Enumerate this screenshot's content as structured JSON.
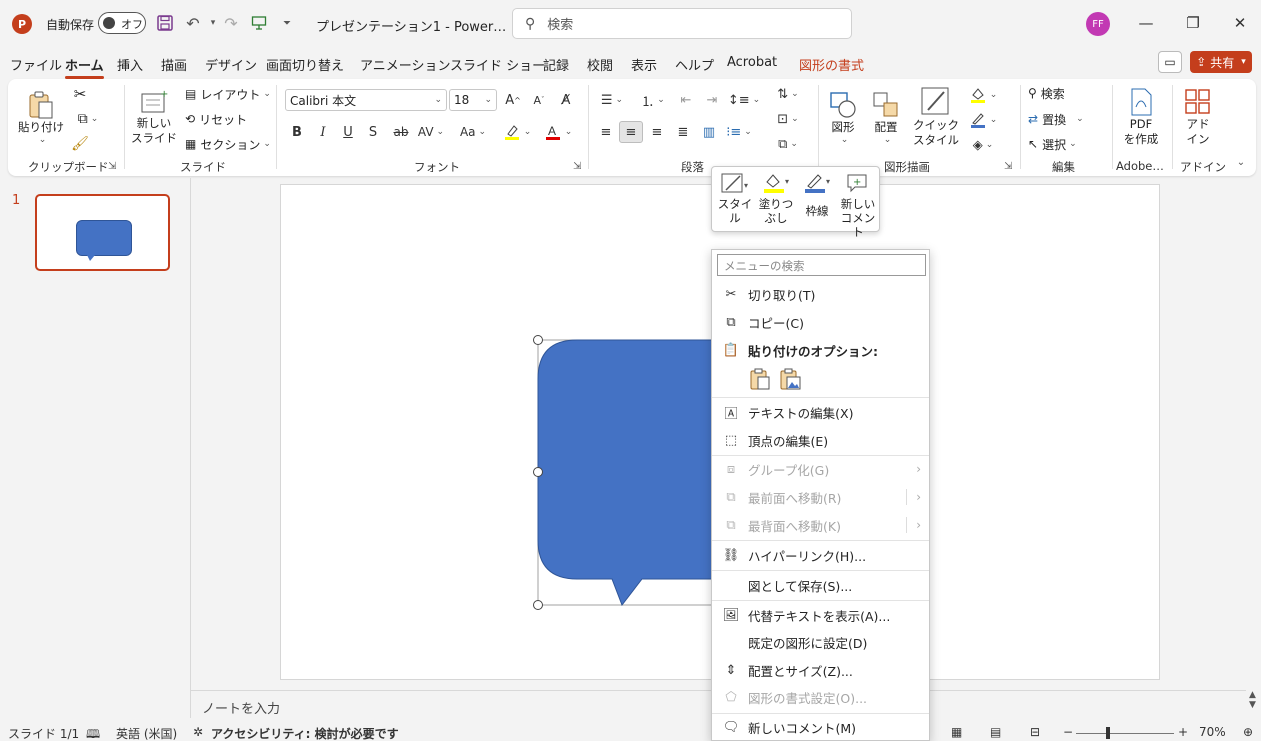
{
  "titlebar": {
    "logo": "P",
    "autosave_label": "自動保存",
    "autosave_state": "オフ",
    "doc_title": "プレゼンテーション1 - Power…",
    "search_placeholder": "検索",
    "user_initials": "FF",
    "icons": [
      "save-icon",
      "undo-icon",
      "redo-icon",
      "present-icon",
      "customize-icon",
      "minimize-icon",
      "restore-icon",
      "close-icon"
    ]
  },
  "menu": {
    "tabs": [
      "ファイル",
      "ホーム",
      "挿入",
      "描画",
      "デザイン",
      "画面切り替え",
      "アニメーション",
      "スライド ショー",
      "記録",
      "校閲",
      "表示",
      "ヘルプ",
      "Acrobat",
      "図形の書式"
    ],
    "active_tab": "ホーム",
    "share_label": "共有"
  },
  "ribbon": {
    "clipboard": {
      "paste": "貼り付け",
      "label": "クリップボード"
    },
    "slides": {
      "new_slide_1": "新しい",
      "new_slide_2": "スライド",
      "layout": "レイアウト",
      "reset": "リセット",
      "section": "セクション",
      "label": "スライド"
    },
    "font": {
      "family": "Calibri 本文",
      "size": "18",
      "bold": "B",
      "italic": "I",
      "underline": "U",
      "shadow": "S",
      "strike": "ab",
      "spacing": "AV",
      "case": "Aa",
      "label": "フォント"
    },
    "paragraph": {
      "label": "段落"
    },
    "drawing": {
      "shapes": "図形",
      "arrange": "配置",
      "quick_1": "クイック",
      "quick_2": "スタイル",
      "label": "図形描画"
    },
    "editing": {
      "find": "検索",
      "replace": "置換",
      "select": "選択",
      "label": "編集"
    },
    "adobe": {
      "pdf_1": "PDF",
      "pdf_2": "を作成",
      "label": "Adobe…"
    },
    "addins": {
      "addin_1": "アド",
      "addin_2": "イン",
      "label": "アドイン"
    },
    "colors": {
      "highlight": "#ffff00",
      "font_color": "#e00000",
      "accent": "#c43e1c"
    }
  },
  "slides_panel": {
    "slide_number": "1"
  },
  "canvas": {
    "shape_fill": "#4472c4",
    "notes_placeholder": "ノートを入力"
  },
  "mini_toolbar": {
    "style_1": "スタイ",
    "style_2": "ル",
    "fill_1": "塗りつ",
    "fill_2": "ぶし",
    "outline": "枠線",
    "comment_1": "新しい",
    "comment_2": "コメント"
  },
  "context_menu": {
    "search_placeholder": "メニューの検索",
    "cut": "切り取り(T)",
    "copy": "コピー(C)",
    "paste_options": "貼り付けのオプション:",
    "edit_text": "テキストの編集(X)",
    "edit_points": "頂点の編集(E)",
    "group": "グループ化(G)",
    "bring_front": "最前面へ移動(R)",
    "send_back": "最背面へ移動(K)",
    "hyperlink": "ハイパーリンク(H)...",
    "save_picture": "図として保存(S)...",
    "alt_text": "代替テキストを表示(A)...",
    "set_default": "既定の図形に設定(D)",
    "size_position": "配置とサイズ(Z)...",
    "format_shape": "図形の書式設定(O)...",
    "new_comment": "新しいコメント(M)"
  },
  "status": {
    "slide_info": "スライド 1/1",
    "language": "英語 (米国)",
    "accessibility": "アクセシビリティ: 検討が必要です",
    "zoom": "70%"
  }
}
